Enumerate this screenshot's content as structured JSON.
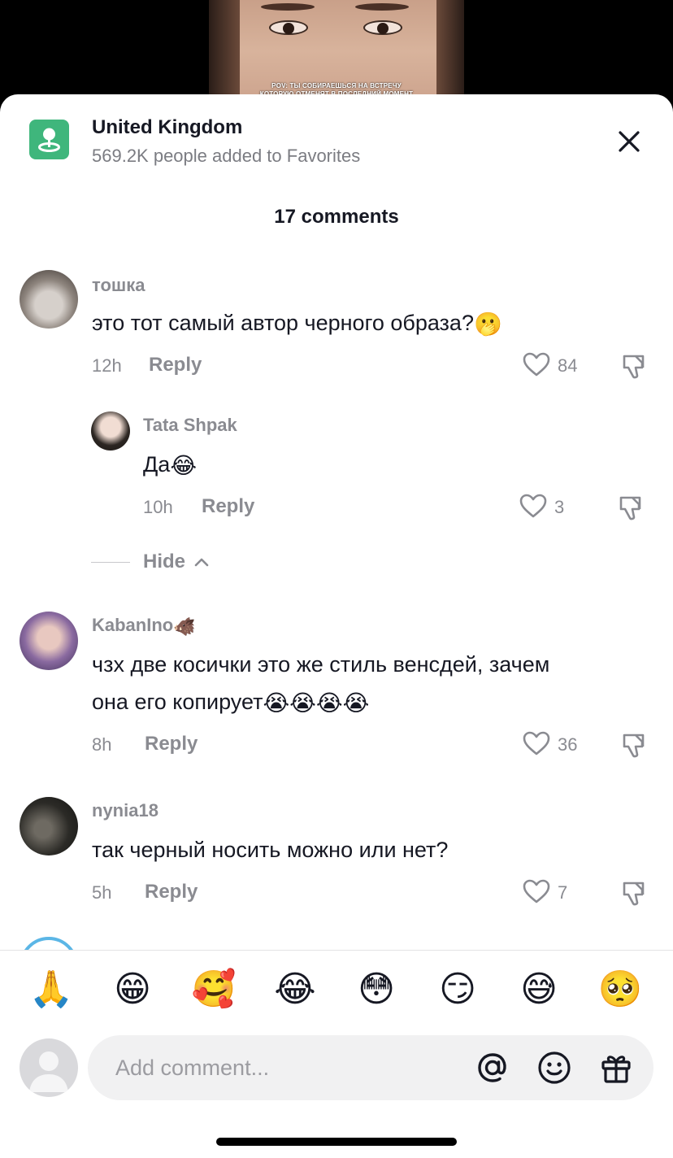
{
  "video": {
    "caption_line1": "POV: ТЫ СОБИРАЕШЬСЯ НА ВСТРЕЧУ",
    "caption_line2": "КОТОРУЮ ОТМЕНЯТ В ПОСЛЕДНИЙ МОМЕНТ"
  },
  "header": {
    "location_title": "United Kingdom",
    "location_subtitle": "569.2K people added to Favorites",
    "icon": "map-pin-icon",
    "accent_color": "#3fb67c"
  },
  "comments_title": "17 comments",
  "comments": [
    {
      "username": "тошка",
      "text": "это тот самый автор черного образа?",
      "emoji": "🫢",
      "time": "12h",
      "reply_label": "Reply",
      "likes": "84"
    },
    {
      "username": "Tata Shpak",
      "text": "Да",
      "emoji": "😂",
      "time": "10h",
      "reply_label": "Reply",
      "likes": "3"
    },
    {
      "username": "KabanIno",
      "username_emoji": "🐗",
      "text_line1": "чзх две косички это же стиль венсдей, зачем",
      "text_line2": "она его копирует",
      "emoji": "😭😭😭😭",
      "time": "8h",
      "reply_label": "Reply",
      "likes": "36"
    },
    {
      "username": "nynia18",
      "text": "так черный носить можно или нет?",
      "time": "5h",
      "reply_label": "Reply",
      "likes": "7"
    }
  ],
  "hide_label": "Hide",
  "quick_emojis": [
    "🙏",
    "😁",
    "🥰",
    "😂",
    "😳",
    "😏",
    "😅",
    "🥺"
  ],
  "composer": {
    "placeholder": "Add comment...",
    "icons": [
      "mention-icon",
      "emoji-icon",
      "gift-icon"
    ]
  }
}
